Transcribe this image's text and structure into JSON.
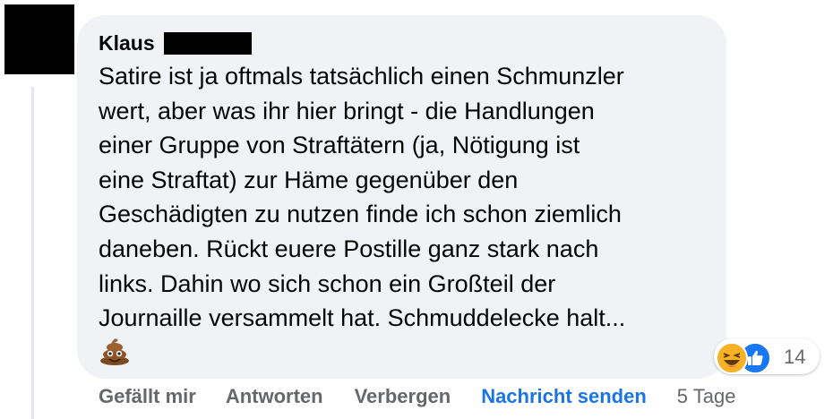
{
  "comment": {
    "author": "Klaus",
    "text": "Satire ist ja oftmals tatsächlich einen Schmunzler\nwert, aber was ihr hier bringt - die Handlungen\neiner Gruppe von Straftätern (ja, Nötigung ist\neine Straftat) zur Häme gegenüber den\nGeschädigten zu nutzen finde ich schon ziemlich\ndaneben. Rückt euere Postille ganz stark nach\nlinks. Dahin wo sich schon ein Großteil der\nJournaille versammelt hat. Schmuddelecke halt...",
    "emoji": "poop-emoji"
  },
  "reactions": {
    "icons": [
      "haha-reaction-icon",
      "like-reaction-icon"
    ],
    "count": "14"
  },
  "actions": {
    "like": "Gefällt mir",
    "reply": "Antworten",
    "hide": "Verbergen",
    "message": "Nachricht senden",
    "time": "5 Tage"
  },
  "colors": {
    "bubble": "#f0f2f5",
    "link_blue": "#1b74e4",
    "muted": "#65676b"
  }
}
